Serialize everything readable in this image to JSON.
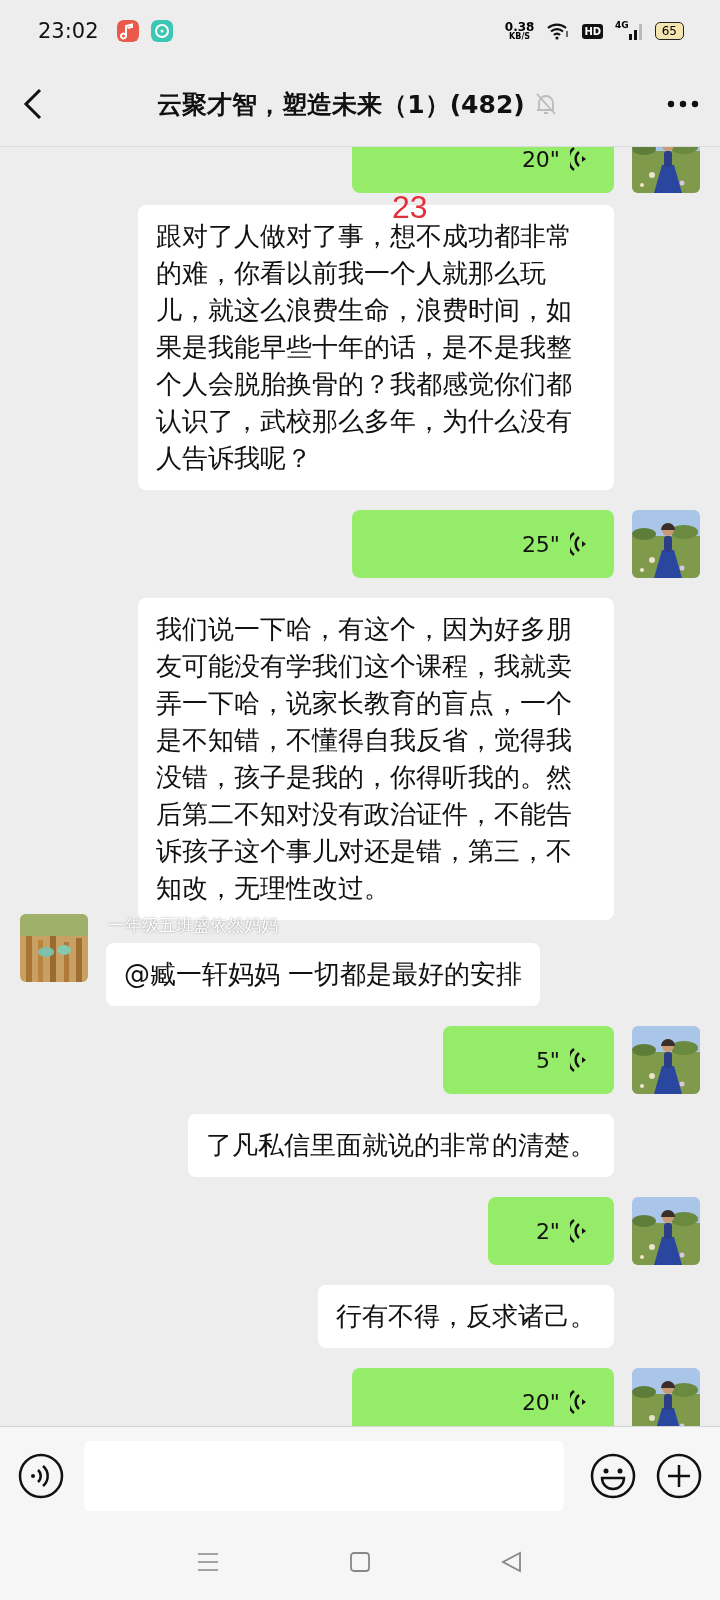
{
  "status_bar": {
    "time": "23:02",
    "net_speed_value": "0.38",
    "net_speed_unit": "KB/S",
    "hd": "HD",
    "network": "4G",
    "battery": "65"
  },
  "header": {
    "title": "云聚才智，塑造未来（1）(482)",
    "muted": true
  },
  "overlay_number": "23",
  "messages": [
    {
      "kind": "voice",
      "duration": "20\""
    },
    {
      "kind": "text",
      "text": "跟对了人做对了事，想不成功都非常的难，你看以前我一个人就那么玩儿，就这么浪费生命，浪费时间，如果是我能早些十年的话，是不是我整个人会脱胎换骨的？我都感觉你们都认识了，武校那么多年，为什么没有人告诉我呢？"
    },
    {
      "kind": "voice",
      "duration": "25\""
    },
    {
      "kind": "text",
      "text": "我们说一下哈，有这个，因为好多朋友可能没有学我们这个课程，我就卖弄一下哈，说家长教育的盲点，一个是不知错，不懂得自我反省，觉得我没错，孩子是我的，你得听我的。然后第二不知对没有政治证件，不能告诉孩子这个事儿对还是错，第三，不知改，无理性改过。"
    },
    {
      "kind": "incoming",
      "sender": "一年级五班盛依然妈妈",
      "text": "@臧一轩妈妈  一切都是最好的安排"
    },
    {
      "kind": "voice",
      "duration": "5\""
    },
    {
      "kind": "text",
      "text": "了凡私信里面就说的非常的清楚。"
    },
    {
      "kind": "voice",
      "duration": "2\""
    },
    {
      "kind": "text",
      "text": "行有不得，反求诸己。"
    },
    {
      "kind": "voice",
      "duration": "20\""
    }
  ]
}
